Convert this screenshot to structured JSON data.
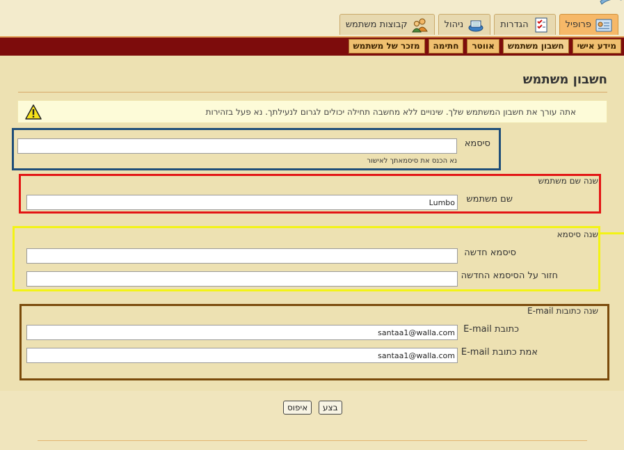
{
  "top_tabs": [
    {
      "label": "פרופיל",
      "icon": "profile-card-icon",
      "active": true
    },
    {
      "label": "הגדרות",
      "icon": "checklist-icon",
      "active": false
    },
    {
      "label": "ניהול",
      "icon": "admin-box-icon",
      "active": false
    },
    {
      "label": "קבוצות משתמש",
      "icon": "user-groups-icon",
      "active": false
    }
  ],
  "sub_tabs": [
    {
      "label": "מידע אישי",
      "active": false
    },
    {
      "label": "חשבון משתמש",
      "active": true
    },
    {
      "label": "אווטר",
      "active": false
    },
    {
      "label": "חתימה",
      "active": false
    },
    {
      "label": "מזכר של משתמש",
      "active": false
    }
  ],
  "page": {
    "title": "חשבון משתמש",
    "warning": "אתה עורך את חשבון המשתמש שלך. שינויים ללא מחשבה תחילה יכולים לגרום לנעילתך. נא פעל בזהירות",
    "warning_icon": "warning-triangle-icon"
  },
  "current_password": {
    "label": "סיסמא",
    "value": "",
    "hint": "נא הכנס את סיסמאתך לאישור"
  },
  "change_username": {
    "legend": "שנה שם משתמש",
    "label": "שם משתמש",
    "value": "Lumbo"
  },
  "change_password": {
    "legend": "שנה סיסמא",
    "new_label": "סיסמא חדשה",
    "new_value": "",
    "repeat_label": "חזור על הסיסמא החדשה",
    "repeat_value": ""
  },
  "change_email": {
    "legend": "שנה כתובות E-mail",
    "email_label": "כתובת E-mail",
    "email_value": "santaa1@walla.com",
    "confirm_label": "אמת כתובת E-mail",
    "confirm_value": "santaa1@walla.com"
  },
  "actions": {
    "submit_label": "בצע",
    "reset_label": "איפוס"
  },
  "colors": {
    "background": "#f0e5bd",
    "red_bar": "#7d0c0c",
    "annotation_blue": "#1f4e79",
    "annotation_red": "#e31414",
    "annotation_yellow": "#f3f315",
    "annotation_brown": "#7a4a0a"
  }
}
